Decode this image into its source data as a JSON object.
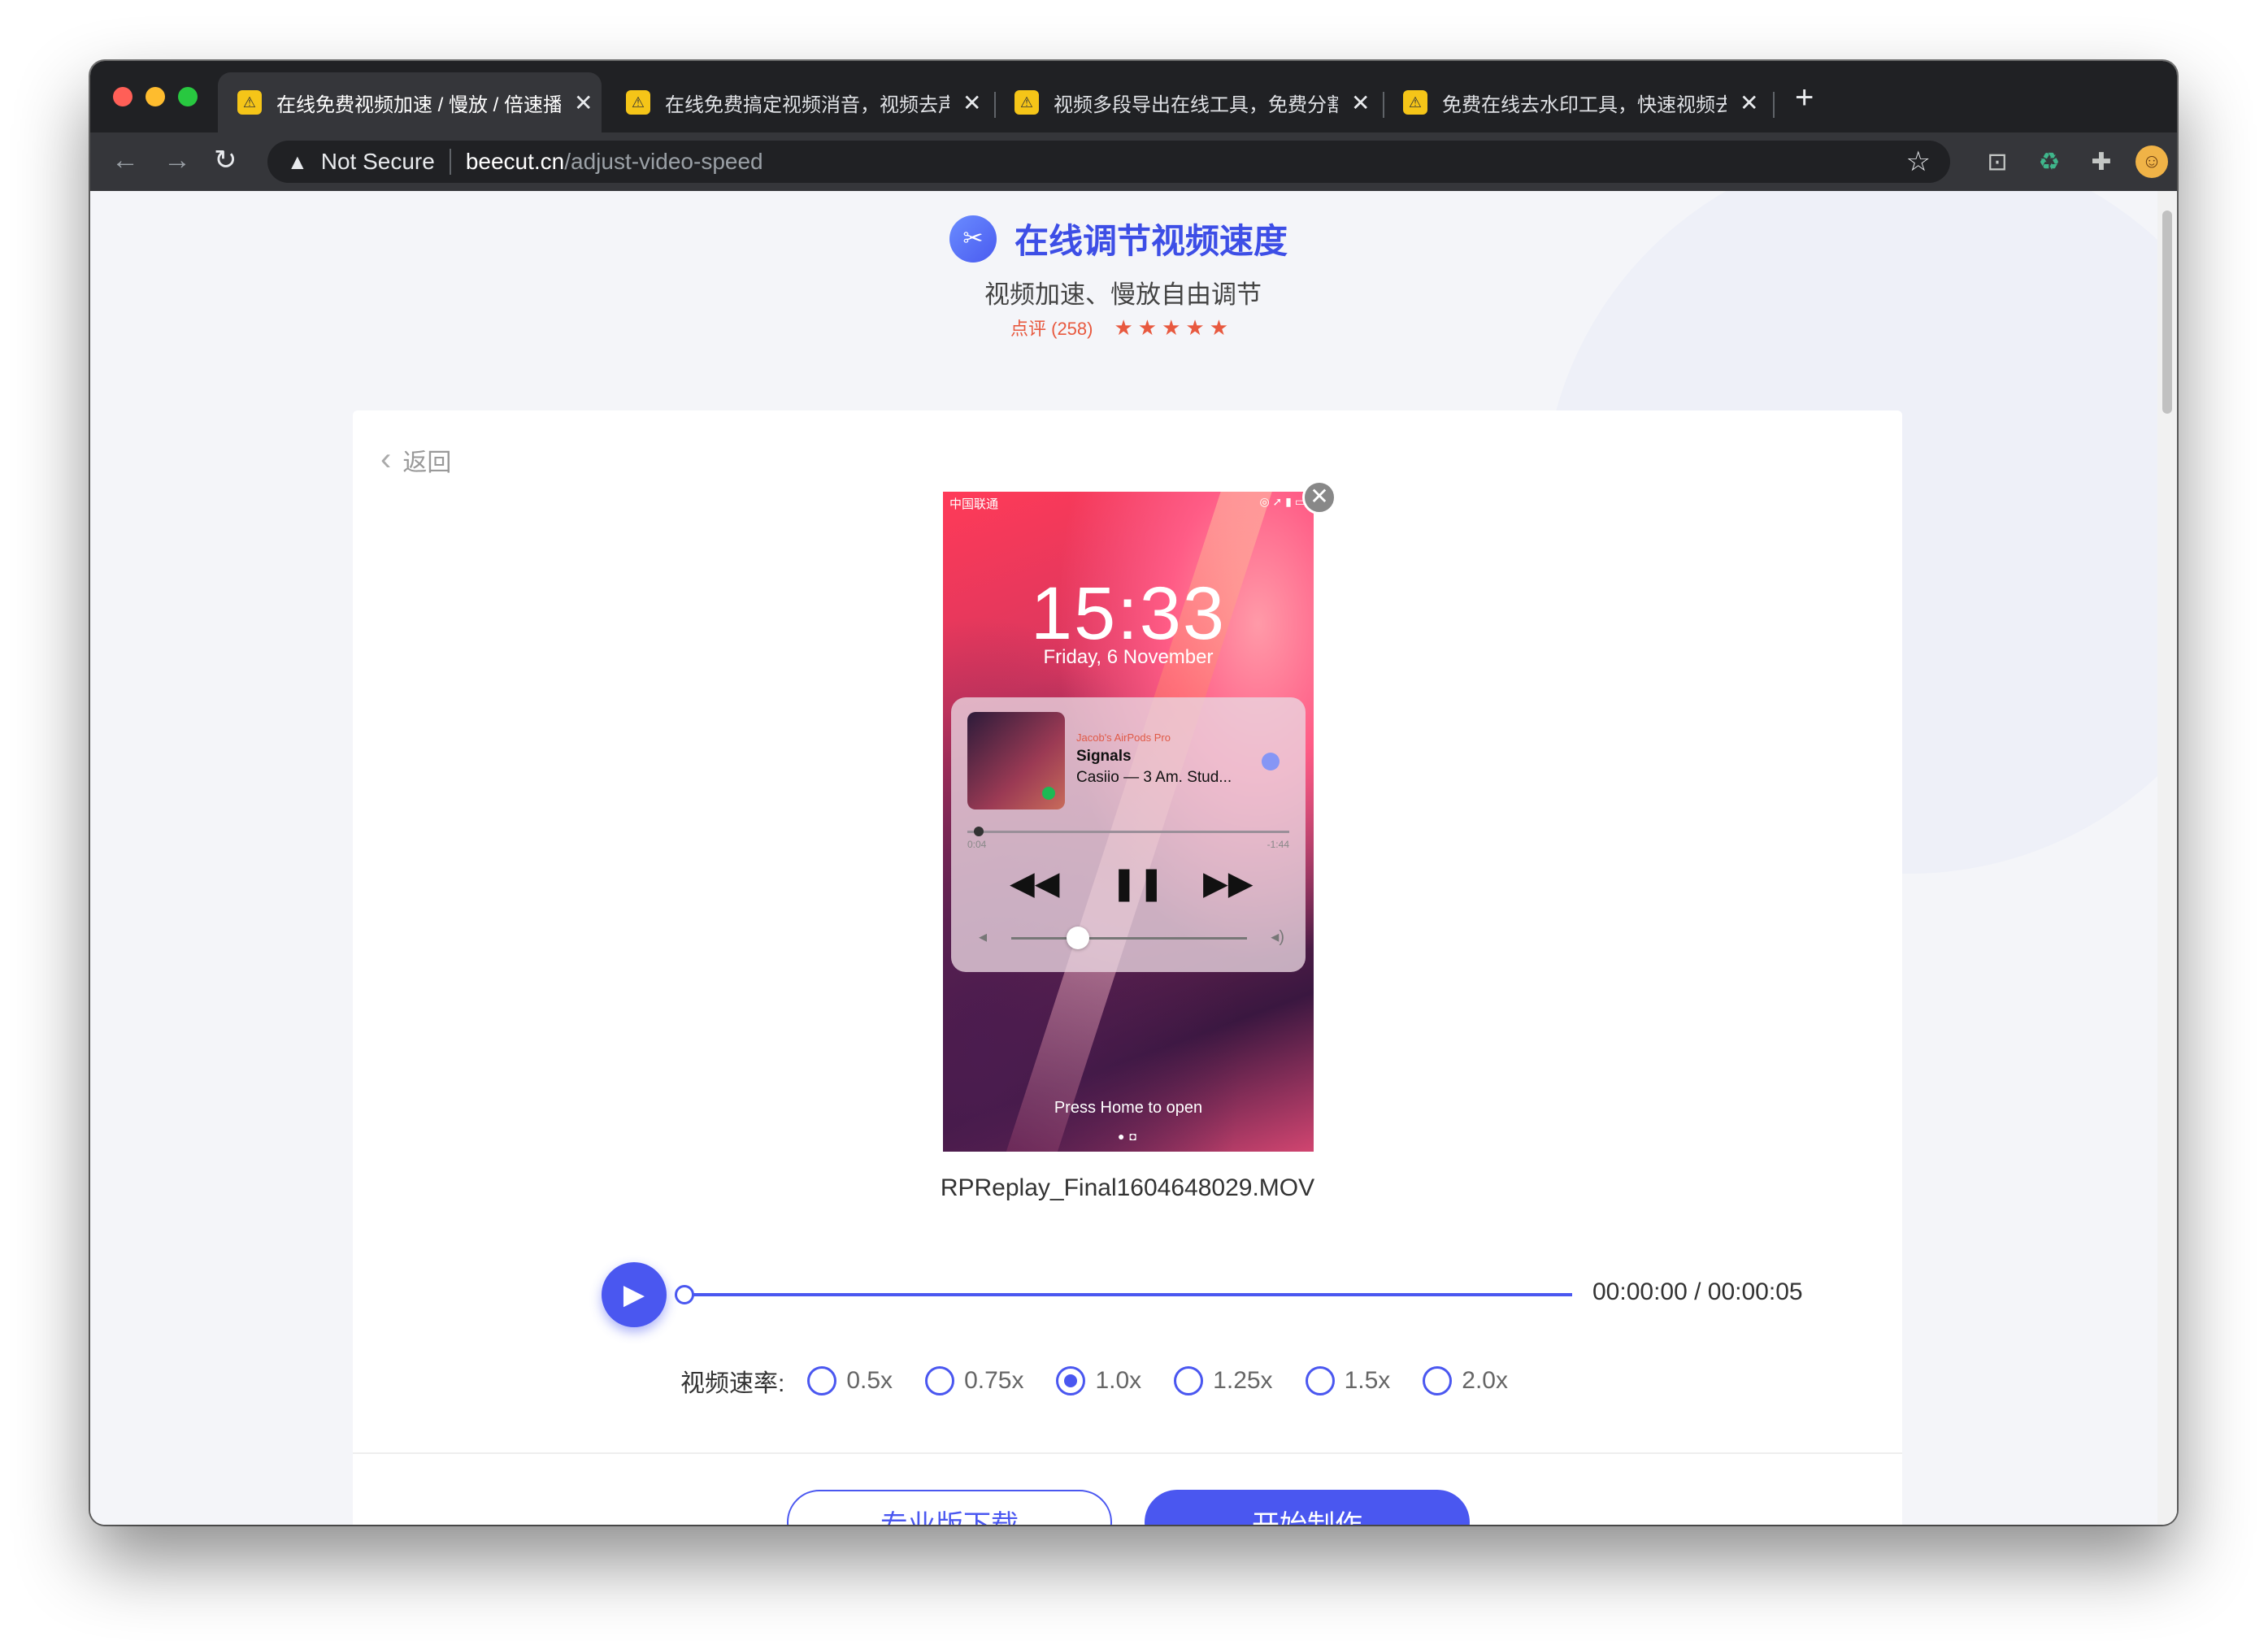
{
  "browser": {
    "tabs": [
      {
        "title": "在线免费视频加速 / 慢放 / 倍速播",
        "active": true
      },
      {
        "title": "在线免费搞定视频消音，视频去声",
        "active": false
      },
      {
        "title": "视频多段导出在线工具，免费分割",
        "active": false
      },
      {
        "title": "免费在线去水印工具，快速视频去",
        "active": false
      }
    ],
    "new_tab": "+",
    "close_glyph": "✕",
    "security_label": "Not Secure",
    "url_host": "beecut.cn",
    "url_path": "/adjust-video-speed"
  },
  "header": {
    "title": "在线调节视频速度",
    "subtitle": "视频加速、慢放自由调节",
    "reviews": "点评 (258)",
    "stars": "★★★★★"
  },
  "card": {
    "back_label": "返回",
    "file_name": "RPReplay_Final1604648029.MOV",
    "time_display": "00:00:00 / 00:00:05",
    "progress": 0,
    "rate_label": "视频速率:",
    "rates": [
      "0.5x",
      "0.75x",
      "1.0x",
      "1.25x",
      "1.5x",
      "2.0x"
    ],
    "selected_rate": "1.0x",
    "pro_download_label": "专业版下载",
    "start_label": "开始制作"
  },
  "video_frame": {
    "carrier": "中国联通",
    "clock": "15:33",
    "date": "Friday, 6 November",
    "device": "Jacob's AirPods Pro",
    "song": "Signals",
    "artist": "Casiio — 3 Am. Stud...",
    "elapsed": "0:04",
    "remaining": "-1:44",
    "press_home": "Press Home to open"
  },
  "colors": {
    "accent": "#4a57f0",
    "review": "#e8593f"
  }
}
